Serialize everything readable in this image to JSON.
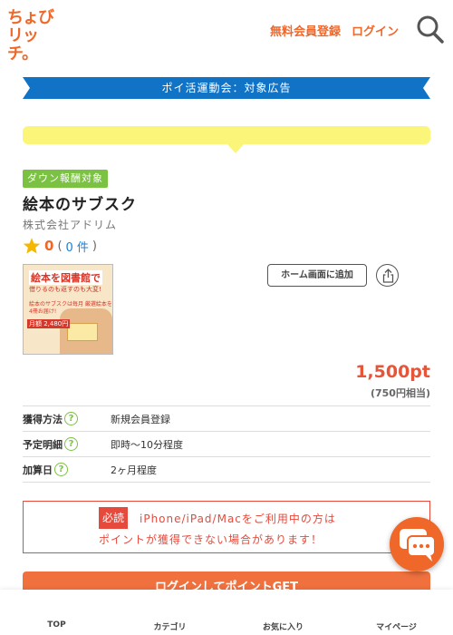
{
  "header": {
    "logo_line1": "ちょび",
    "logo_line2": "リッチ。",
    "register_label": "無料会員登録",
    "login_label": "ログイン"
  },
  "campaign": {
    "label": "ポイ活運動会：対象広告"
  },
  "offer": {
    "badge": "ダウン報酬対象",
    "title": "絵本のサブスク",
    "company": "株式会社アドリム",
    "rating_value": "0",
    "rating_open": "(",
    "review_count": "0 件",
    "rating_close": ")",
    "thumbnail": {
      "headline": "絵本を図書館で",
      "subline": "借りるのも返すのも大変!",
      "body": "絵本のサブスクは毎月 厳選絵本を4冊お届け!",
      "price": "月額 2,480円"
    },
    "home_button_label": "ホーム画面に追加",
    "points": "1,500pt",
    "points_yen": "(750円相当)"
  },
  "info_rows": [
    {
      "key": "獲得方法",
      "value": "新規会員登録"
    },
    {
      "key": "予定明細",
      "value": "即時～10分程度"
    },
    {
      "key": "加算日",
      "value": "2ヶ月程度"
    }
  ],
  "notice": {
    "required_label": "必読",
    "line1": "iPhone/iPad/Macをご利用中の方は",
    "line2": "ポイントが獲得できない場合があります！"
  },
  "cta": {
    "login_label": "ログインしてポイントGET"
  },
  "bottom_nav": [
    {
      "label": "TOP"
    },
    {
      "label": "カテゴリ"
    },
    {
      "label": "お気に入り"
    },
    {
      "label": "マイページ"
    }
  ],
  "colors": {
    "brand": "#f0672a",
    "ribbon": "#1073c6",
    "badge": "#7cc242",
    "alert": "#e64a3c",
    "highlight": "#fbf57a"
  }
}
